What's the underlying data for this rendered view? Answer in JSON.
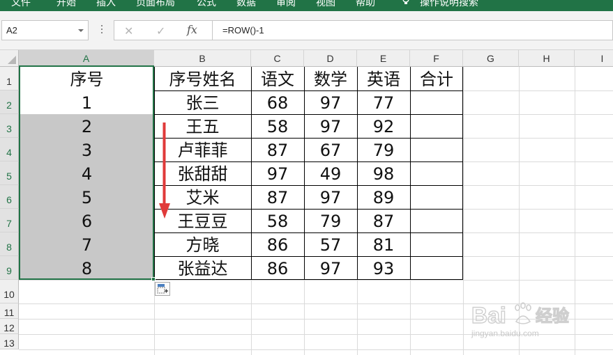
{
  "ribbon": {
    "tabs": [
      "文件",
      "开始",
      "插入",
      "页面布局",
      "公式",
      "数据",
      "审阅",
      "视图",
      "帮助"
    ],
    "tell_me": "操作说明搜索",
    "color": "#217346"
  },
  "formula_bar": {
    "name_box": "A2",
    "formula": "=ROW()-1",
    "cancel_icon": "close-icon",
    "enter_icon": "check-icon",
    "fx_label": "fx"
  },
  "grid": {
    "columns": [
      "A",
      "B",
      "C",
      "D",
      "E",
      "F",
      "G",
      "H",
      "I"
    ],
    "rows": [
      "1",
      "2",
      "3",
      "4",
      "5",
      "6",
      "7",
      "8",
      "9",
      "10",
      "11",
      "12",
      "13"
    ],
    "selected_column": "A",
    "selected_range": "A2:A9"
  },
  "table": {
    "header": [
      "序号",
      "序号姓名",
      "语文",
      "数学",
      "英语",
      "合计"
    ],
    "rows": [
      [
        "1",
        "张三",
        "68",
        "97",
        "77",
        ""
      ],
      [
        "2",
        "王五",
        "58",
        "97",
        "92",
        ""
      ],
      [
        "3",
        "卢菲菲",
        "87",
        "67",
        "79",
        ""
      ],
      [
        "4",
        "张甜甜",
        "97",
        "49",
        "98",
        ""
      ],
      [
        "5",
        "艾米",
        "87",
        "97",
        "89",
        ""
      ],
      [
        "6",
        "王豆豆",
        "58",
        "79",
        "87",
        ""
      ],
      [
        "7",
        "方晓",
        "86",
        "57",
        "81",
        ""
      ],
      [
        "8",
        "张益达",
        "86",
        "97",
        "93",
        ""
      ]
    ]
  },
  "annotation": {
    "arrow_direction": "down",
    "arrow_color": "#e03a3a"
  },
  "watermark": {
    "logo": "Bai 经验",
    "url": "jingyan.baidu.com"
  }
}
